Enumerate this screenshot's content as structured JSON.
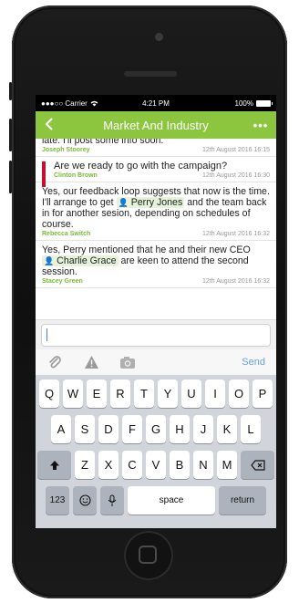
{
  "status_bar": {
    "carrier": "●●●○○ Carrier",
    "time": "4:21 PM",
    "battery": "100%"
  },
  "nav": {
    "back_icon": "chevron-left-icon",
    "title": "Market And Industry",
    "more": "•••"
  },
  "messages": [
    {
      "text": "late. I'll post some info soon.",
      "author": "Joseph Stoorey",
      "date": "12th August 2016 16:15"
    },
    {
      "alert": true,
      "alert_color": "#c8102e",
      "text": "Are we ready to go with the campaign?",
      "author": "Clinton Brown",
      "date": "12th August 2016 16:30"
    },
    {
      "text_before": "Yes, our feedback loop suggests that now is the time. I'll arrange to get",
      "mention": "Perry Jones",
      "text_after": "and the team back in for another sesion, depending on schedules of course.",
      "author": "Rebecca Switch",
      "date": "12th August 2016 16:32"
    },
    {
      "text_before": "Yes, Perry mentioned that he and their new CEO",
      "mention": "Charlie Grace",
      "text_after": "are keen to attend the second session.",
      "author": "Stacey Green",
      "date": "12th August 2016 16:32"
    }
  ],
  "composer": {
    "value": "",
    "send_label": "Send"
  },
  "keyboard": {
    "row1": [
      "Q",
      "W",
      "E",
      "R",
      "T",
      "Y",
      "U",
      "I",
      "O",
      "P"
    ],
    "row2": [
      "A",
      "S",
      "D",
      "F",
      "G",
      "H",
      "J",
      "K",
      "L"
    ],
    "row3": [
      "Z",
      "X",
      "C",
      "V",
      "B",
      "N",
      "M"
    ],
    "numbers_label": "123",
    "space_label": "space",
    "return_label": "return"
  },
  "colors": {
    "accent": "#8cc63f",
    "author": "#7cb83a",
    "mention_bg": "#e6f2d9"
  }
}
